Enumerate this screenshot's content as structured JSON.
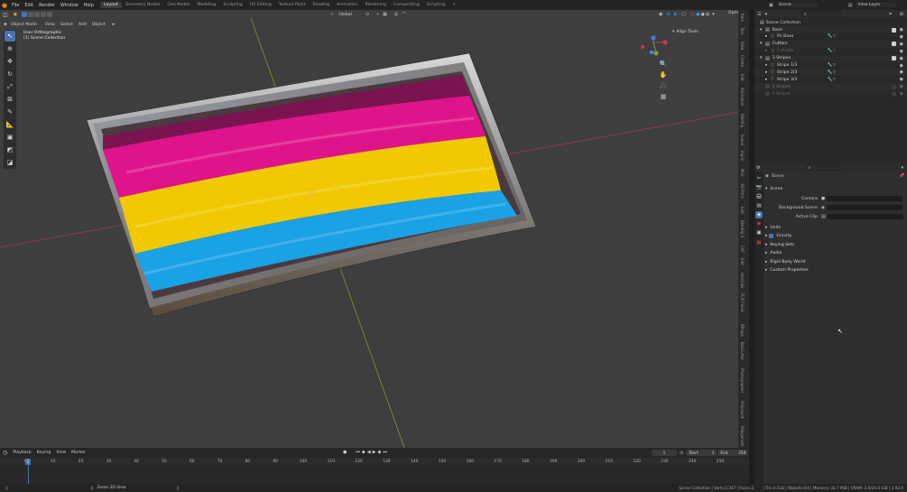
{
  "topbar": {
    "menus": [
      "File",
      "Edit",
      "Render",
      "Window",
      "Help"
    ],
    "workspaces": [
      "Layout",
      "Geometry Nodes",
      "Geo Nodes",
      "Modeling",
      "Sculpting",
      "UV Editing",
      "Texture Paint",
      "Shading",
      "Animation",
      "Rendering",
      "Compositing",
      "Scripting"
    ],
    "active_workspace": "Layout",
    "add_workspace": "+",
    "scene_name": "Scene",
    "view_layer": "View Layer"
  },
  "viewport": {
    "mode": "Object Mode",
    "menus": [
      "View",
      "Select",
      "Add",
      "Object"
    ],
    "orientation": "Global",
    "options_label": "Options",
    "overlay_title": "User Orthographic",
    "overlay_collection": "(1) Scene Collection",
    "align_tools": "Align Tools",
    "flag_colors": [
      "#e0148a",
      "#f2c900",
      "#1aa2e6"
    ]
  },
  "ntabs": [
    "Item",
    "Tool",
    "View",
    "Create",
    "Edit",
    "Animation",
    "BlenRig",
    "Scene",
    "Rigify",
    "Misc",
    "3D-Print",
    "Edit",
    "BlenRig 6",
    "CAT",
    "Edit",
    "HardOps",
    "FLIP Fluids",
    "BProps",
    "BoxCutter",
    "Photographer",
    "Polycount",
    "Polygonizer"
  ],
  "timeline": {
    "menus": [
      "Playback",
      "Keying",
      "View",
      "Marker"
    ],
    "current_frame": "1",
    "start_label": "Start",
    "start": "1",
    "end_label": "End",
    "end": "250",
    "ticks": [
      "0",
      "10",
      "20",
      "30",
      "40",
      "50",
      "60",
      "70",
      "80",
      "90",
      "100",
      "110",
      "120",
      "130",
      "140",
      "150",
      "160",
      "170",
      "180",
      "190",
      "200",
      "210",
      "220",
      "230",
      "240",
      "250"
    ],
    "playhead": "1"
  },
  "statusbar": {
    "hint": "Zoom 2D View",
    "info": "Scene Collection | Verts:2,347 | Faces:2,424 | Tris:4,518 | Objects:0/4 | Memory: 32.7 MiB | VRAM: 2.0/24.0 GiB | 2.92.0"
  },
  "outliner": {
    "root": "Scene Collection",
    "rows": [
      {
        "label": "Base",
        "indent": 1,
        "type": "collection"
      },
      {
        "label": "Pri Base",
        "indent": 2,
        "type": "object"
      },
      {
        "label": "Cutters",
        "indent": 1,
        "type": "collection"
      },
      {
        "label": "Cylinder",
        "indent": 2,
        "type": "object-dim"
      },
      {
        "label": "3 Stripes",
        "indent": 1,
        "type": "collection"
      },
      {
        "label": "Stripe 1/3",
        "indent": 2,
        "type": "object"
      },
      {
        "label": "Stripe 2/3",
        "indent": 2,
        "type": "object"
      },
      {
        "label": "Stripe 3/3",
        "indent": 2,
        "type": "object"
      },
      {
        "label": "4 Stripes",
        "indent": 1,
        "type": "dim"
      },
      {
        "label": "5 Stripes",
        "indent": 1,
        "type": "dim"
      }
    ]
  },
  "properties": {
    "context": "Scene",
    "panel_scene": "Scene",
    "camera_label": "Camera",
    "background_scene_label": "Background Scene",
    "active_clip_label": "Active Clip",
    "sections": [
      "Units",
      "Gravity",
      "Keying Sets",
      "Audio",
      "Rigid Body World",
      "Custom Properties"
    ]
  }
}
